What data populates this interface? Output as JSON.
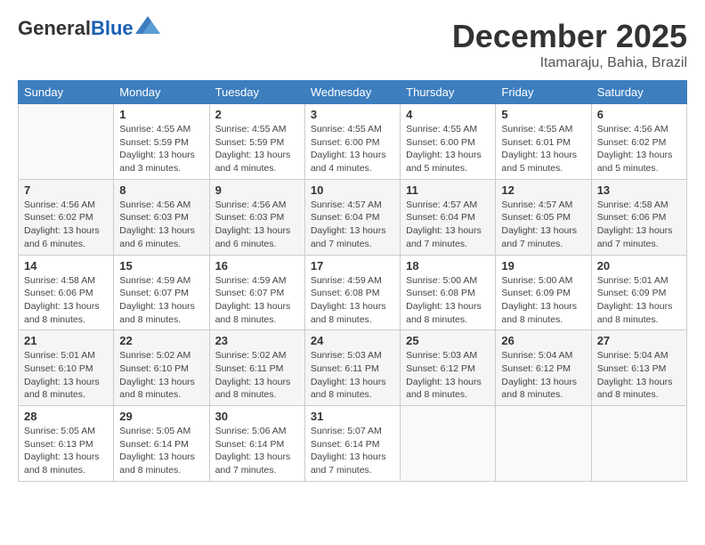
{
  "header": {
    "logo_line1": "General",
    "logo_line2": "Blue",
    "month": "December 2025",
    "location": "Itamaraju, Bahia, Brazil"
  },
  "weekdays": [
    "Sunday",
    "Monday",
    "Tuesday",
    "Wednesday",
    "Thursday",
    "Friday",
    "Saturday"
  ],
  "weeks": [
    [
      {
        "day": "",
        "info": ""
      },
      {
        "day": "1",
        "info": "Sunrise: 4:55 AM\nSunset: 5:59 PM\nDaylight: 13 hours\nand 3 minutes."
      },
      {
        "day": "2",
        "info": "Sunrise: 4:55 AM\nSunset: 5:59 PM\nDaylight: 13 hours\nand 4 minutes."
      },
      {
        "day": "3",
        "info": "Sunrise: 4:55 AM\nSunset: 6:00 PM\nDaylight: 13 hours\nand 4 minutes."
      },
      {
        "day": "4",
        "info": "Sunrise: 4:55 AM\nSunset: 6:00 PM\nDaylight: 13 hours\nand 5 minutes."
      },
      {
        "day": "5",
        "info": "Sunrise: 4:55 AM\nSunset: 6:01 PM\nDaylight: 13 hours\nand 5 minutes."
      },
      {
        "day": "6",
        "info": "Sunrise: 4:56 AM\nSunset: 6:02 PM\nDaylight: 13 hours\nand 5 minutes."
      }
    ],
    [
      {
        "day": "7",
        "info": "Sunrise: 4:56 AM\nSunset: 6:02 PM\nDaylight: 13 hours\nand 6 minutes."
      },
      {
        "day": "8",
        "info": "Sunrise: 4:56 AM\nSunset: 6:03 PM\nDaylight: 13 hours\nand 6 minutes."
      },
      {
        "day": "9",
        "info": "Sunrise: 4:56 AM\nSunset: 6:03 PM\nDaylight: 13 hours\nand 6 minutes."
      },
      {
        "day": "10",
        "info": "Sunrise: 4:57 AM\nSunset: 6:04 PM\nDaylight: 13 hours\nand 7 minutes."
      },
      {
        "day": "11",
        "info": "Sunrise: 4:57 AM\nSunset: 6:04 PM\nDaylight: 13 hours\nand 7 minutes."
      },
      {
        "day": "12",
        "info": "Sunrise: 4:57 AM\nSunset: 6:05 PM\nDaylight: 13 hours\nand 7 minutes."
      },
      {
        "day": "13",
        "info": "Sunrise: 4:58 AM\nSunset: 6:06 PM\nDaylight: 13 hours\nand 7 minutes."
      }
    ],
    [
      {
        "day": "14",
        "info": "Sunrise: 4:58 AM\nSunset: 6:06 PM\nDaylight: 13 hours\nand 8 minutes."
      },
      {
        "day": "15",
        "info": "Sunrise: 4:59 AM\nSunset: 6:07 PM\nDaylight: 13 hours\nand 8 minutes."
      },
      {
        "day": "16",
        "info": "Sunrise: 4:59 AM\nSunset: 6:07 PM\nDaylight: 13 hours\nand 8 minutes."
      },
      {
        "day": "17",
        "info": "Sunrise: 4:59 AM\nSunset: 6:08 PM\nDaylight: 13 hours\nand 8 minutes."
      },
      {
        "day": "18",
        "info": "Sunrise: 5:00 AM\nSunset: 6:08 PM\nDaylight: 13 hours\nand 8 minutes."
      },
      {
        "day": "19",
        "info": "Sunrise: 5:00 AM\nSunset: 6:09 PM\nDaylight: 13 hours\nand 8 minutes."
      },
      {
        "day": "20",
        "info": "Sunrise: 5:01 AM\nSunset: 6:09 PM\nDaylight: 13 hours\nand 8 minutes."
      }
    ],
    [
      {
        "day": "21",
        "info": "Sunrise: 5:01 AM\nSunset: 6:10 PM\nDaylight: 13 hours\nand 8 minutes."
      },
      {
        "day": "22",
        "info": "Sunrise: 5:02 AM\nSunset: 6:10 PM\nDaylight: 13 hours\nand 8 minutes."
      },
      {
        "day": "23",
        "info": "Sunrise: 5:02 AM\nSunset: 6:11 PM\nDaylight: 13 hours\nand 8 minutes."
      },
      {
        "day": "24",
        "info": "Sunrise: 5:03 AM\nSunset: 6:11 PM\nDaylight: 13 hours\nand 8 minutes."
      },
      {
        "day": "25",
        "info": "Sunrise: 5:03 AM\nSunset: 6:12 PM\nDaylight: 13 hours\nand 8 minutes."
      },
      {
        "day": "26",
        "info": "Sunrise: 5:04 AM\nSunset: 6:12 PM\nDaylight: 13 hours\nand 8 minutes."
      },
      {
        "day": "27",
        "info": "Sunrise: 5:04 AM\nSunset: 6:13 PM\nDaylight: 13 hours\nand 8 minutes."
      }
    ],
    [
      {
        "day": "28",
        "info": "Sunrise: 5:05 AM\nSunset: 6:13 PM\nDaylight: 13 hours\nand 8 minutes."
      },
      {
        "day": "29",
        "info": "Sunrise: 5:05 AM\nSunset: 6:14 PM\nDaylight: 13 hours\nand 8 minutes."
      },
      {
        "day": "30",
        "info": "Sunrise: 5:06 AM\nSunset: 6:14 PM\nDaylight: 13 hours\nand 7 minutes."
      },
      {
        "day": "31",
        "info": "Sunrise: 5:07 AM\nSunset: 6:14 PM\nDaylight: 13 hours\nand 7 minutes."
      },
      {
        "day": "",
        "info": ""
      },
      {
        "day": "",
        "info": ""
      },
      {
        "day": "",
        "info": ""
      }
    ]
  ]
}
